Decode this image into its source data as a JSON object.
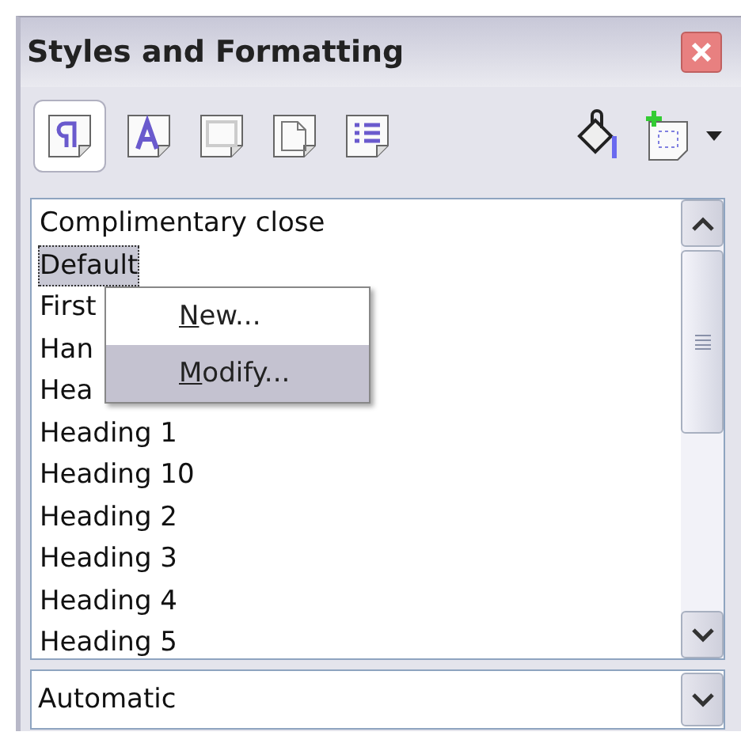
{
  "window": {
    "title": "Styles and Formatting"
  },
  "toolbar": {
    "categories": [
      {
        "selected": true
      },
      {
        "selected": false
      },
      {
        "selected": false
      },
      {
        "selected": false
      },
      {
        "selected": false
      }
    ]
  },
  "styles": [
    {
      "label": "Complimentary close",
      "selected": false
    },
    {
      "label": "Default",
      "selected": true
    },
    {
      "label": "First",
      "selected": false
    },
    {
      "label": "Han",
      "selected": false
    },
    {
      "label": "Hea",
      "selected": false
    },
    {
      "label": "Heading 1",
      "selected": false
    },
    {
      "label": "Heading 10",
      "selected": false
    },
    {
      "label": "Heading 2",
      "selected": false
    },
    {
      "label": "Heading 3",
      "selected": false
    },
    {
      "label": "Heading 4",
      "selected": false
    },
    {
      "label": "Heading 5",
      "selected": false
    }
  ],
  "context_menu": [
    {
      "label": "New...",
      "selected": false
    },
    {
      "label": "Modify...",
      "selected": true
    }
  ],
  "filter": {
    "value": "Automatic"
  }
}
